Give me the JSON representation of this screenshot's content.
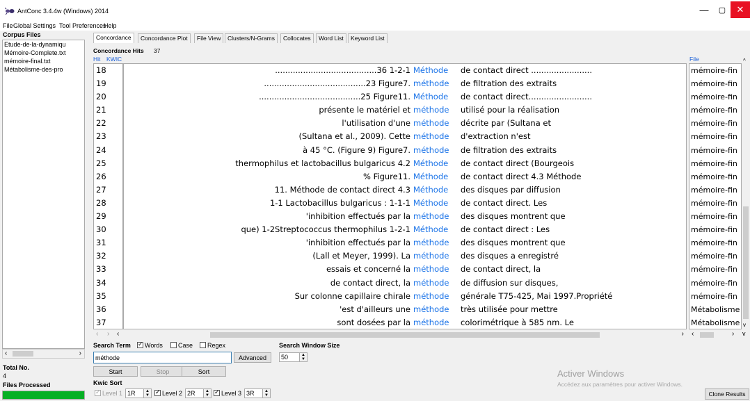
{
  "window": {
    "title": "AntConc 3.4.4w (Windows) 2014",
    "minimize_glyph": "—",
    "maximize_glyph": "▢",
    "close_glyph": "✕",
    "close_color": "#e81123"
  },
  "menubar": [
    "File",
    "Global Settings",
    "Tool Preferences",
    "Help"
  ],
  "sidebar": {
    "corpus_title": "Corpus Files",
    "files": [
      "Etude-de-la-dynamiqu",
      "Mémoire-Complete.txt",
      "mémoire-final.txt",
      "Métabolisme-des-pro"
    ],
    "total_label": "Total No.",
    "total_value": "4",
    "files_processed_label": "Files Processed",
    "progress_fraction": 1.0,
    "progress_color": "#06b025"
  },
  "tabs": [
    "Concordance",
    "Concordance Plot",
    "File View",
    "Clusters/N-Grams",
    "Collocates",
    "Word List",
    "Keyword List"
  ],
  "active_tab": 0,
  "concordance": {
    "hits_label": "Concordance Hits",
    "hits_count": "37",
    "col_hit": "Hit",
    "col_kwic": "KWIC",
    "col_file": "File",
    "node_color": "#1a73e8",
    "rows": [
      {
        "hit": "18",
        "left": "........................................36        1-2-1",
        "node": "Méthode",
        "right": "de contact direct ........................",
        "file": "mémoire-fin"
      },
      {
        "hit": "19",
        "left": "........................................23  Figure7.",
        "node": "méthode",
        "right": "de filtration des extraits",
        "file": "mémoire-fin"
      },
      {
        "hit": "20",
        "left": "........................................25  Figure11.",
        "node": "Méthode",
        "right": "de contact direct.........................",
        "file": "mémoire-fin"
      },
      {
        "hit": "21",
        "left": "présente le matériel et",
        "node": "méthode",
        "right": "utilisé pour la réalisation",
        "file": "mémoire-fin"
      },
      {
        "hit": "22",
        "left": "l'utilisation d'une",
        "node": "méthode",
        "right": "décrite par (Sultana et",
        "file": "mémoire-fin"
      },
      {
        "hit": "23",
        "left": "(Sultana et al., 2009). Cette",
        "node": "méthode",
        "right": "d'extraction n'est",
        "file": "mémoire-fin"
      },
      {
        "hit": "24",
        "left": "à 45 °C. (Figure 9)          Figure7.",
        "node": "méthode",
        "right": "de filtration des extraits",
        "file": "mémoire-fin"
      },
      {
        "hit": "25",
        "left": "thermophilus et lactobacillus bulgaricus  4.2",
        "node": "Méthode",
        "right": "de contact direct (Bourgeois",
        "file": "mémoire-fin"
      },
      {
        "hit": "26",
        "left": "%                                          Figure11.",
        "node": "Méthode",
        "right": "de contact direct    4.3 Méthode",
        "file": "mémoire-fin"
      },
      {
        "hit": "27",
        "left": "11. Méthode de contact direct    4.3",
        "node": "Méthode",
        "right": "des disques par diffusion",
        "file": "mémoire-fin"
      },
      {
        "hit": "28",
        "left": "1-1 Lactobacillus bulgaricus :  1-1-1",
        "node": "Méthode",
        "right": "de contact direct.  Les",
        "file": "mémoire-fin"
      },
      {
        "hit": "29",
        "left": "'inhibition effectués par la",
        "node": "méthode",
        "right": "des disques montrent que",
        "file": "mémoire-fin"
      },
      {
        "hit": "30",
        "left": "que)     1-2Streptococcus thermophilus   1-2-1",
        "node": "Méthode",
        "right": "de contact direct :      Les",
        "file": "mémoire-fin"
      },
      {
        "hit": "31",
        "left": "'inhibition effectués par la",
        "node": "méthode",
        "right": "des disques montrent que",
        "file": "mémoire-fin"
      },
      {
        "hit": "32",
        "left": "(Lall et Meyer, 1999).   La",
        "node": "méthode",
        "right": "des disques a enregistré",
        "file": "mémoire-fin"
      },
      {
        "hit": "33",
        "left": "essais et concerné la",
        "node": "méthode",
        "right": "de contact direct, la",
        "file": "mémoire-fin"
      },
      {
        "hit": "34",
        "left": "de contact direct, la",
        "node": "méthode",
        "right": "de diffusion sur disques,",
        "file": "mémoire-fin"
      },
      {
        "hit": "35",
        "left": "Sur colonne capillaire chirale",
        "node": "méthode",
        "right": "générale T75-425, Mai 1997.Propriété",
        "file": "mémoire-fin"
      },
      {
        "hit": "36",
        "left": "'est d'ailleurs une",
        "node": "méthode",
        "right": "très utilisée pour mettre",
        "file": "Métabolisme"
      },
      {
        "hit": "37",
        "left": "sont dosées          par la",
        "node": "méthode",
        "right": "colorimétrique à 585 nm.      Le",
        "file": "Métabolisme"
      }
    ]
  },
  "search": {
    "label": "Search Term",
    "words_label": "Words",
    "words_checked": true,
    "case_label": "Case",
    "case_checked": false,
    "regex_label": "Regex",
    "regex_checked": false,
    "value": "méthode",
    "advanced_label": "Advanced",
    "window_size_label": "Search Window Size",
    "window_size_value": "50"
  },
  "buttons": {
    "start": "Start",
    "stop": "Stop",
    "sort": "Sort",
    "clone": "Clone Results"
  },
  "kwic_sort": {
    "label": "Kwic Sort",
    "level1_label": "Level 1",
    "level1_value": "1R",
    "level1_checked": true,
    "level2_label": "Level 2",
    "level2_value": "2R",
    "level2_checked": true,
    "level3_label": "Level 3",
    "level3_value": "3R",
    "level3_checked": true
  },
  "watermark": {
    "line1": "Activer Windows",
    "line2": "Accédez aux paramètres pour activer Windows."
  }
}
